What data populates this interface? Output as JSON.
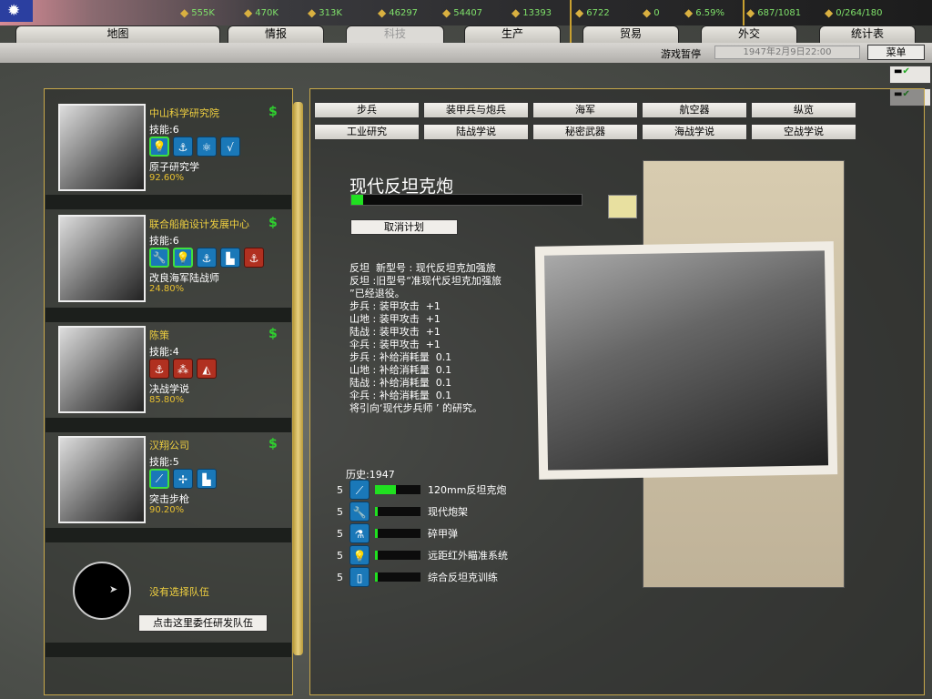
{
  "resources": [
    {
      "icon": "energy-icon",
      "value": "555K"
    },
    {
      "icon": "metal-icon",
      "value": "470K"
    },
    {
      "icon": "rare-materials-icon",
      "value": "313K"
    },
    {
      "icon": "oil-icon",
      "value": "46297"
    },
    {
      "icon": "supplies-icon",
      "value": "54407"
    },
    {
      "icon": "money-icon",
      "value": "13393"
    },
    {
      "icon": "manpower-icon",
      "value": "6722"
    },
    {
      "icon": "nuclear-icon",
      "value": "0"
    },
    {
      "icon": "dissent-icon",
      "value": "6.59%"
    },
    {
      "icon": "transport-icon",
      "value": "687/1081"
    },
    {
      "icon": "convoy-icon",
      "value": "0/264/180"
    }
  ],
  "tabs": [
    "地图",
    "情报",
    "科技",
    "生产",
    "贸易",
    "外交",
    "统计表"
  ],
  "status": {
    "paused": "游戏暂停",
    "date": "1947年2月9日22:00",
    "menu": "菜单"
  },
  "teams": [
    {
      "name": "中山科学研究院",
      "skill": "技能:6",
      "project": "原子研究学",
      "progress": "92.60%",
      "icons": [
        "lightbulb",
        "anchor",
        "atom",
        "math"
      ]
    },
    {
      "name": "联合船舶设计发展中心",
      "skill": "技能:6",
      "project": "改良海军陆战师",
      "progress": "24.80%",
      "icons": [
        "wrench",
        "lightbulb",
        "anchor",
        "factory",
        "naval-doctrine"
      ]
    },
    {
      "name": "陈策",
      "skill": "技能:4",
      "project": "决战学说",
      "progress": "85.80%",
      "icons": [
        "naval-doctrine",
        "fleet",
        "sextant"
      ]
    },
    {
      "name": "汉翔公司",
      "skill": "技能:5",
      "project": "突击步枪",
      "progress": "90.20%",
      "icons": [
        "artillery",
        "propeller",
        "factory"
      ]
    }
  ],
  "no_team": "没有选择队伍",
  "assign_team": "点击这里委任研发队伍",
  "cat_row1": [
    "步兵",
    "装甲兵与炮兵",
    "海军",
    "航空器",
    "纵览"
  ],
  "cat_row2": [
    "工业研究",
    "陆战学说",
    "秘密武器",
    "海战学说",
    "空战学说"
  ],
  "tech": {
    "title": "现代反坦克炮",
    "progress": 5,
    "cancel": "取消计划",
    "description": "反坦  新型号 : 现代反坦克加强旅\n反坦 :旧型号“准现代反坦克加强旅\n”已经退役。\n步兵 : 装甲攻击  +1\n山地 : 装甲攻击  +1\n陆战 : 装甲攻击  +1\n伞兵 : 装甲攻击  +1\n步兵 : 补给消耗量  0.1\n山地 : 补给消耗量  0.1\n陆战 : 补给消耗量  0.1\n伞兵 : 补给消耗量  0.1\n将引向‘现代步兵师 ’ 的研究。",
    "history": "历史:1947",
    "components": [
      {
        "level": "5",
        "icon": "artillery",
        "name": "120mm反坦克炮",
        "progress": 45
      },
      {
        "level": "5",
        "icon": "wrench",
        "name": "现代炮架",
        "progress": 3
      },
      {
        "level": "5",
        "icon": "flask",
        "name": "碎甲弹",
        "progress": 3
      },
      {
        "level": "5",
        "icon": "lightbulb",
        "name": "远距红外瞄准系统",
        "progress": 3
      },
      {
        "level": "5",
        "icon": "book",
        "name": "综合反坦克训练",
        "progress": 3
      }
    ]
  }
}
